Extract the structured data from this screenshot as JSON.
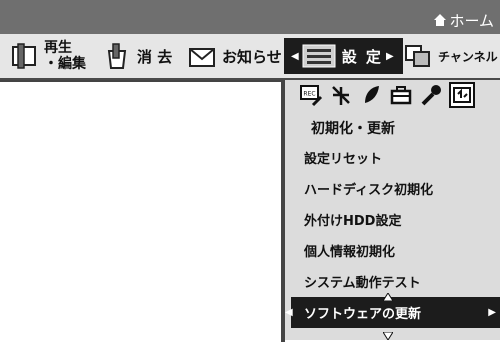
{
  "header": {
    "home_label": "ホーム"
  },
  "menubar": {
    "items": [
      {
        "label_line1": "再生",
        "label_line2": "・編集"
      },
      {
        "label": "消 去"
      },
      {
        "label": "お知らせ"
      },
      {
        "label": "設 定"
      },
      {
        "label": "チャンネル"
      }
    ]
  },
  "submenu": {
    "icons": [
      "rec-icon",
      "antenna-icon",
      "leaf-icon",
      "toolbox-icon",
      "wrench-icon",
      "update-icon"
    ],
    "section_title": "初期化・更新",
    "items": [
      "設定リセット",
      "ハードディスク初期化",
      "外付けHDD設定",
      "個人情報初期化",
      "システム動作テスト",
      "ソフトウェアの更新"
    ],
    "selected_index": 5
  }
}
